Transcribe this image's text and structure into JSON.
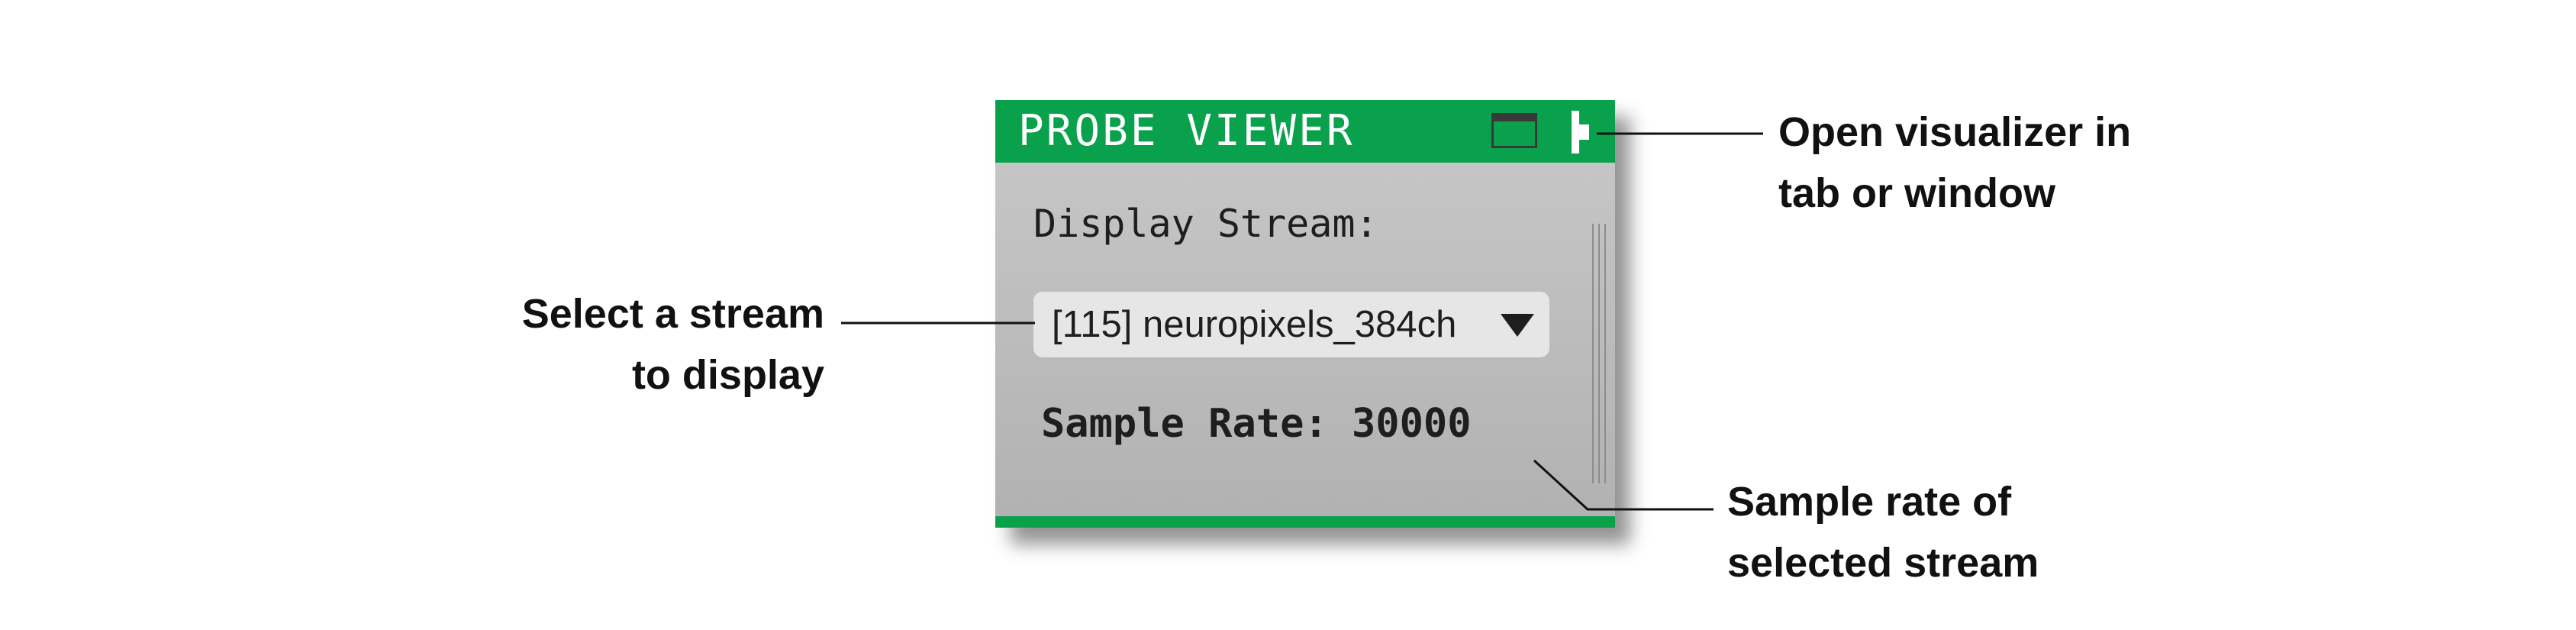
{
  "window": {
    "title": "PROBE VIEWER",
    "tab_icon": "tab-icon",
    "window_icon": "open-window-icon",
    "accent_color": "#0aa14d"
  },
  "stream": {
    "label": "Display Stream:",
    "selected": "[115] neuropixels_384ch",
    "caret_icon": "caret-down-icon"
  },
  "sample_rate": {
    "text": "Sample Rate: 30000"
  },
  "annotations": {
    "left": [
      "Select a stream",
      "to display"
    ],
    "top_right": [
      "Open visualizer in",
      "tab or window"
    ],
    "bottom_right": [
      "Sample rate of",
      "selected stream"
    ]
  }
}
